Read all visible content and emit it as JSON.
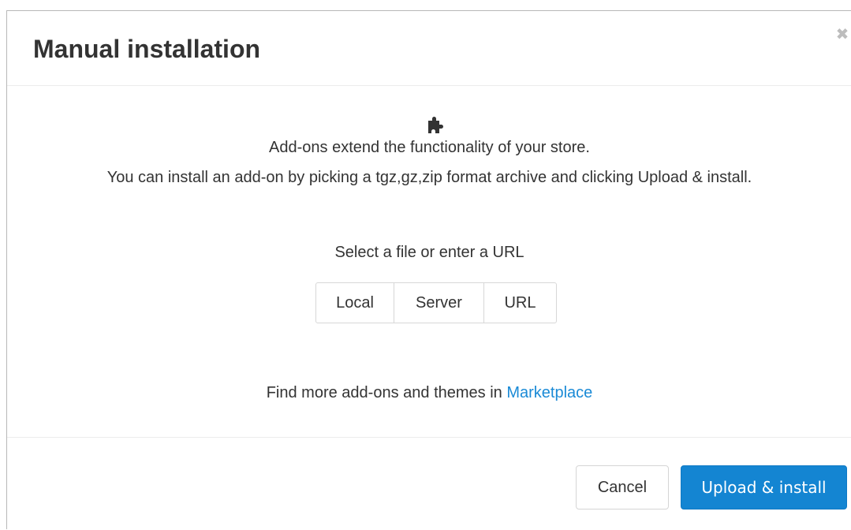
{
  "dialog": {
    "title": "Manual installation",
    "close_icon": "close-icon",
    "close_glyph": "✖",
    "icon": "puzzle-piece-icon",
    "description_line1": "Add-ons extend the functionality of your store.",
    "description_line2": "You can install an add-on by picking a tgz,gz,zip format archive and clicking Upload & install.",
    "select_label": "Select a file or enter a URL",
    "sources": [
      {
        "label": "Local"
      },
      {
        "label": "Server"
      },
      {
        "label": "URL"
      }
    ],
    "more_text": "Find more add-ons and themes in ",
    "marketplace_link": "Marketplace",
    "cancel_label": "Cancel",
    "submit_label": "Upload & install"
  },
  "colors": {
    "primary": "#1485d2",
    "link": "#1a8ad6",
    "text": "#333333",
    "border": "#d7d7d7"
  }
}
